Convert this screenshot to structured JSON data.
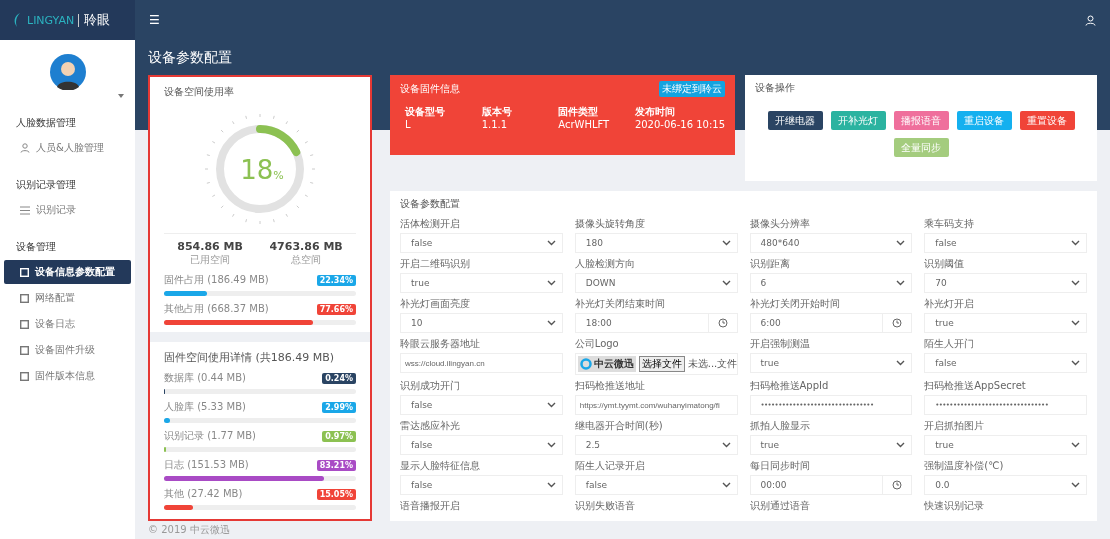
{
  "header": {
    "logo_text": "LINGYAN",
    "logo_brand": "聆眼",
    "menu_icon": "☰"
  },
  "sidebar": {
    "sections": [
      {
        "title": "人脸数据管理",
        "items": [
          {
            "label": "人员&人脸管理",
            "selected": false
          }
        ]
      },
      {
        "title": "识别记录管理",
        "items": [
          {
            "label": "识别记录",
            "selected": false
          }
        ]
      },
      {
        "title": "设备管理",
        "items": [
          {
            "label": "设备信息参数配置",
            "selected": true
          },
          {
            "label": "网络配置",
            "selected": false
          },
          {
            "label": "设备日志",
            "selected": false
          },
          {
            "label": "设备固件升级",
            "selected": false
          },
          {
            "label": "固件版本信息",
            "selected": false
          }
        ]
      }
    ]
  },
  "page_title": "设备参数配置",
  "storage": {
    "title": "设备空间使用率",
    "gauge": {
      "value": "18",
      "unit": "%",
      "level": 0.18
    },
    "used": {
      "value": "854.86 MB",
      "label": "已用空间"
    },
    "total": {
      "value": "4763.86 MB",
      "label": "总空间"
    },
    "bars": [
      {
        "label": "固件占用 (186.49 MB)",
        "badge": "22.34%",
        "color": "#1aa7e8",
        "level": 0.2234
      },
      {
        "label": "其他占用 (668.37 MB)",
        "badge": "77.66%",
        "color": "#f04438",
        "level": 0.7766
      }
    ]
  },
  "firmware_usage": {
    "title": "固件空间使用详情 (共186.49 MB)",
    "items": [
      {
        "label": "数据库 (0.44 MB)",
        "badge": "0.24%",
        "color": "#2a4463",
        "level": 0.0024
      },
      {
        "label": "人脸库 (5.33 MB)",
        "badge": "2.99%",
        "color": "#1aa7e8",
        "level": 0.0299
      },
      {
        "label": "识别记录 (1.77 MB)",
        "badge": "0.97%",
        "color": "#8cc152",
        "level": 0.0097
      },
      {
        "label": "日志 (151.53 MB)",
        "badge": "83.21%",
        "color": "#a94bc5",
        "level": 0.8321
      },
      {
        "label": "其他 (27.42 MB)",
        "badge": "15.05%",
        "color": "#f04438",
        "level": 0.1505
      }
    ]
  },
  "firmware_info": {
    "title": "设备固件信息",
    "badge": "未绑定到聆云",
    "fields": [
      {
        "label": "设备型号",
        "value": "L"
      },
      {
        "label": "版本号",
        "value": "1.1.1"
      },
      {
        "label": "固件类型",
        "value": "AcrWHLFT"
      },
      {
        "label": "发布时间",
        "value": "2020-06-16 10:15"
      }
    ]
  },
  "operations": {
    "title": "设备操作",
    "buttons": [
      {
        "label": "开继电器",
        "color": "#2a4463"
      },
      {
        "label": "开补光灯",
        "color": "#2bb3a0"
      },
      {
        "label": "播报语音",
        "color": "#ef6f9c"
      },
      {
        "label": "重启设备",
        "color": "#14b0ef"
      },
      {
        "label": "重置设备",
        "color": "#f04438"
      },
      {
        "label": "全量同步",
        "color": "#a4cc7e"
      }
    ]
  },
  "config": {
    "title": "设备参数配置",
    "fields": [
      {
        "label": "活体检测开启",
        "kind": "select",
        "value": "false"
      },
      {
        "label": "摄像头旋转角度",
        "kind": "select",
        "value": "180"
      },
      {
        "label": "摄像头分辨率",
        "kind": "select",
        "value": "480*640"
      },
      {
        "label": "乘车码支持",
        "kind": "select",
        "value": "false"
      },
      {
        "label": "开启二维码识别",
        "kind": "select",
        "value": "true"
      },
      {
        "label": "人脸检测方向",
        "kind": "select",
        "value": "DOWN"
      },
      {
        "label": "识别距离",
        "kind": "select",
        "value": "6"
      },
      {
        "label": "识别阈值",
        "kind": "select",
        "value": "70"
      },
      {
        "label": "补光灯画面亮度",
        "kind": "select",
        "value": "10"
      },
      {
        "label": "补光灯关闭结束时间",
        "kind": "time",
        "value": "18:00"
      },
      {
        "label": "补光灯关闭开始时间",
        "kind": "time",
        "value": "6:00"
      },
      {
        "label": "补光灯开启",
        "kind": "select",
        "value": "true"
      },
      {
        "label": "聆眼云服务器地址",
        "kind": "text",
        "value": "wss://cloud.ilingyan.cn"
      },
      {
        "label": "公司Logo",
        "kind": "file",
        "logo": "中云微迅",
        "button": "选择文件",
        "value": "未选...文件"
      },
      {
        "label": "开启强制测温",
        "kind": "select",
        "value": "true"
      },
      {
        "label": "陌生人开门",
        "kind": "select",
        "value": "false"
      },
      {
        "label": "识别成功开门",
        "kind": "select",
        "value": "false"
      },
      {
        "label": "扫码枪推送地址",
        "kind": "text",
        "value": "https://ymt.tyymt.com/wuhanyimatong/fi"
      },
      {
        "label": "扫码枪推送AppId",
        "kind": "password",
        "value": "••••••••••••••••••••••••••••••••"
      },
      {
        "label": "扫码枪推送AppSecret",
        "kind": "password",
        "value": "••••••••••••••••••••••••••••••••"
      },
      {
        "label": "雷达感应补光",
        "kind": "select",
        "value": "false"
      },
      {
        "label": "继电器开合时间(秒)",
        "kind": "select",
        "value": "2.5"
      },
      {
        "label": "抓拍人脸显示",
        "kind": "select",
        "value": "true"
      },
      {
        "label": "开启抓拍图片",
        "kind": "select",
        "value": "true"
      },
      {
        "label": "显示人脸特征信息",
        "kind": "select",
        "value": "false"
      },
      {
        "label": "陌生人记录开启",
        "kind": "select",
        "value": "false"
      },
      {
        "label": "每日同步时间",
        "kind": "time",
        "value": "00:00"
      },
      {
        "label": "强制温度补偿(℃)",
        "kind": "select",
        "value": "0.0"
      },
      {
        "label": "语音播报开启",
        "kind": "label"
      },
      {
        "label": "识别失败语音",
        "kind": "label"
      },
      {
        "label": "识别通过语音",
        "kind": "label"
      },
      {
        "label": "快速识别记录",
        "kind": "label"
      }
    ]
  },
  "footer": "© 2019 中云微迅"
}
